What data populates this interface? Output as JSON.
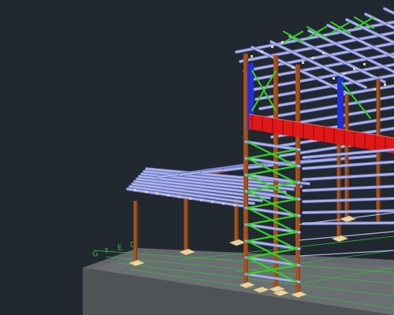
{
  "viewport": {
    "background": "#222830",
    "ground_fill": "#6b6f72",
    "ground_edge": "#4f5356"
  },
  "colors": {
    "steel_column": "#a6521c",
    "steel_column_dark": "#7a3a12",
    "purlin": "#b0b8e8",
    "purlin_edge": "#6e78c8",
    "brace": "#34d11f",
    "highlight_member": "#e01818",
    "blue_column": "#2030d8",
    "base_plate": "#e8d2a0",
    "grid_line": "#2fbf3a",
    "grid_label": "#2fbf3a"
  },
  "grid_labels": [
    "G",
    "F",
    "E",
    "D"
  ]
}
